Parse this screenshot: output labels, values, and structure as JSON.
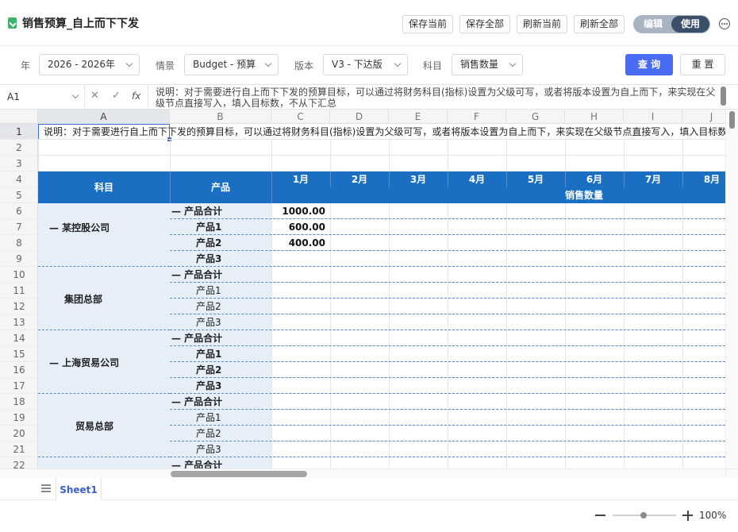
{
  "title": "销售预算_自上而下下发",
  "toolbar": {
    "save_current": "保存当前",
    "save_all": "保存全部",
    "refresh_current": "刷新当前",
    "refresh_all": "刷新全部",
    "mode_edit": "编辑",
    "mode_use": "使用"
  },
  "filters": {
    "year_label": "年",
    "year_value": "2026 - 2026年",
    "scenario_label": "情景",
    "scenario_value": "Budget - 预算",
    "version_label": "版本",
    "version_value": "V3 - 下达版",
    "subject_label": "科目",
    "subject_value": "销售数量",
    "query": "查 询",
    "reset": "重 置"
  },
  "formula": {
    "cell_ref": "A1",
    "fx": "fx",
    "content": "说明：对于需要进行自上而下下发的预算目标，可以通过将财务科目(指标)设置为父级可写，或者将版本设置为自上而下，来实现在父级节点直接写入，填入目标数，不从下汇总"
  },
  "columns": [
    "A",
    "B",
    "C",
    "D",
    "E",
    "F",
    "G",
    "H",
    "I",
    "J"
  ],
  "rows": [
    "1",
    "2",
    "3",
    "4",
    "5",
    "6",
    "7",
    "8",
    "9",
    "10",
    "11",
    "12",
    "13",
    "14",
    "15",
    "16",
    "17",
    "18",
    "19",
    "20",
    "21",
    "22"
  ],
  "description": "说明：对于需要进行自上而下下发的预算目标，可以通过将财务科目(指标)设置为父级可写，或者将版本设置为自上而下，来实现在父级节点直接写入，填入目标数，不从下汇总",
  "table": {
    "header_subject": "科目",
    "header_product": "产品",
    "months": [
      "1月",
      "2月",
      "3月",
      "4月",
      "5月",
      "6月",
      "7月",
      "8月"
    ],
    "measure": "销售数量"
  },
  "groups": [
    {
      "name": "— 某控股公司",
      "items": [
        {
          "product": "— 产品合计",
          "bold": true,
          "value": "1000.00"
        },
        {
          "product": "产品1",
          "bold": true,
          "value": "600.00"
        },
        {
          "product": "产品2",
          "bold": true,
          "value": "400.00"
        },
        {
          "product": "产品3",
          "bold": true,
          "value": ""
        }
      ]
    },
    {
      "name": "集团总部",
      "items": [
        {
          "product": "— 产品合计",
          "bold": true,
          "value": ""
        },
        {
          "product": "产品1",
          "bold": false,
          "value": ""
        },
        {
          "product": "产品2",
          "bold": false,
          "value": ""
        },
        {
          "product": "产品3",
          "bold": false,
          "value": ""
        }
      ]
    },
    {
      "name": "— 上海贸易公司",
      "items": [
        {
          "product": "— 产品合计",
          "bold": true,
          "value": ""
        },
        {
          "product": "产品1",
          "bold": true,
          "value": ""
        },
        {
          "product": "产品2",
          "bold": true,
          "value": ""
        },
        {
          "product": "产品3",
          "bold": true,
          "value": ""
        }
      ]
    },
    {
      "name": "贸易总部",
      "items": [
        {
          "product": "— 产品合计",
          "bold": true,
          "value": ""
        },
        {
          "product": "产品1",
          "bold": false,
          "value": ""
        },
        {
          "product": "产品2",
          "bold": false,
          "value": ""
        },
        {
          "product": "产品3",
          "bold": false,
          "value": ""
        }
      ]
    },
    {
      "name": "",
      "items": [
        {
          "product": "— 产品合计",
          "bold": true,
          "value": ""
        }
      ]
    }
  ],
  "sheet_tab": "Sheet1",
  "zoom": "100%"
}
